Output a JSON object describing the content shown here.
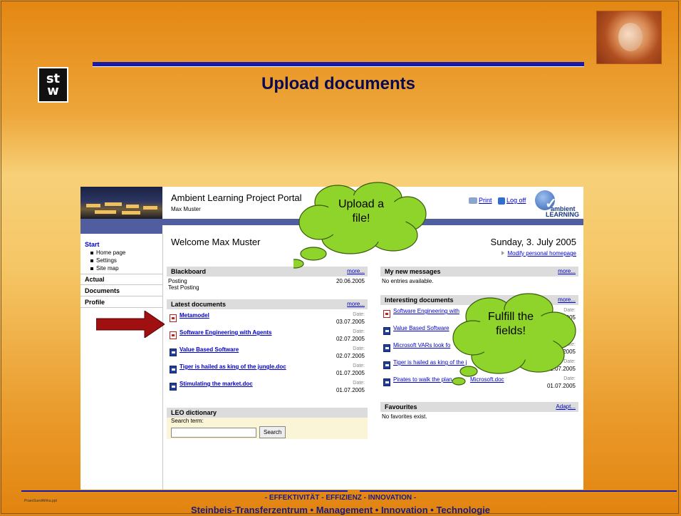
{
  "slide": {
    "title": "Upload documents",
    "logo_text": "st\nw",
    "footer_line1": "- EFFEKTIVITÄT  -  EFFIZIENZ  -  INNOVATION -",
    "footer_line2": "Steinbeis-Transferzentrum • Management  • Innovation  • Technologie",
    "file_name": "PraesSuedAfrika.ppt"
  },
  "portal": {
    "title": "Ambient Learning Project Portal",
    "user": "Max Muster",
    "print_label": "Print",
    "logoff_label": "Log off",
    "brand_1": "ambient",
    "brand_2": "LEARNING",
    "welcome": "Welcome  Max Muster",
    "date": "Sunday, 3. July 2005",
    "modify_link": "Modify personal homepage",
    "nav": {
      "start": "Start",
      "items": [
        "Home page",
        "Settings",
        "Site map"
      ],
      "actual": "Actual",
      "documents": "Documents",
      "profile": "Profile"
    },
    "blackboard": {
      "title": "Blackboard",
      "more": "more...",
      "posting_label": "Posting",
      "posting_text": "Test Posting",
      "posting_date": "20.06.2005"
    },
    "latest": {
      "title": "Latest documents",
      "more": "more...",
      "date_label": "Date:",
      "docs": [
        {
          "name": "Metamodel",
          "date": "03.07.2005"
        },
        {
          "name": "Software Engineering with Agents",
          "date": "02.07.2005"
        },
        {
          "name": "Value Based Software",
          "date": "02.07.2005"
        },
        {
          "name": "Tiger is hailed as king of the jungle.doc",
          "date": "01.07.2005"
        },
        {
          "name": "Stimulating the market.doc",
          "date": "01.07.2005"
        }
      ]
    },
    "leo": {
      "title": "LEO dictionary",
      "search_label": "Search term:",
      "search_button": "Search",
      "search_value": ""
    },
    "messages": {
      "title": "My new messages",
      "more": "more...",
      "text": "No entries available."
    },
    "interesting": {
      "title": "Interesting documents",
      "more": "more...",
      "date_label": "Date:",
      "docs": [
        {
          "name": "Software Engineering with",
          "date": "2005"
        },
        {
          "name": "Value Based Software",
          "date": "2005"
        },
        {
          "name": "Microsoft VARs look fo",
          "date": "01.07.2005"
        },
        {
          "name": "Tiger is hailed as king of the j",
          "date": "01.07.2005"
        },
        {
          "name": "Pirates to walk the plan",
          "name_tail": "Microsoft.doc",
          "date": "01.07.2005"
        }
      ]
    },
    "favourites": {
      "title": "Favourites",
      "adapt": "Adapt...",
      "text": "No favorites exist."
    }
  },
  "callouts": {
    "upload": "Upload a\nfile!",
    "fulfill": "Fulfill the\nfields!"
  },
  "colors": {
    "title": "#0a0a50",
    "rule": "#1a1aa8",
    "portal_band": "#505ea0",
    "cloud": "#8fd42a",
    "arrow": "#a01010",
    "link": "#0000cc"
  }
}
